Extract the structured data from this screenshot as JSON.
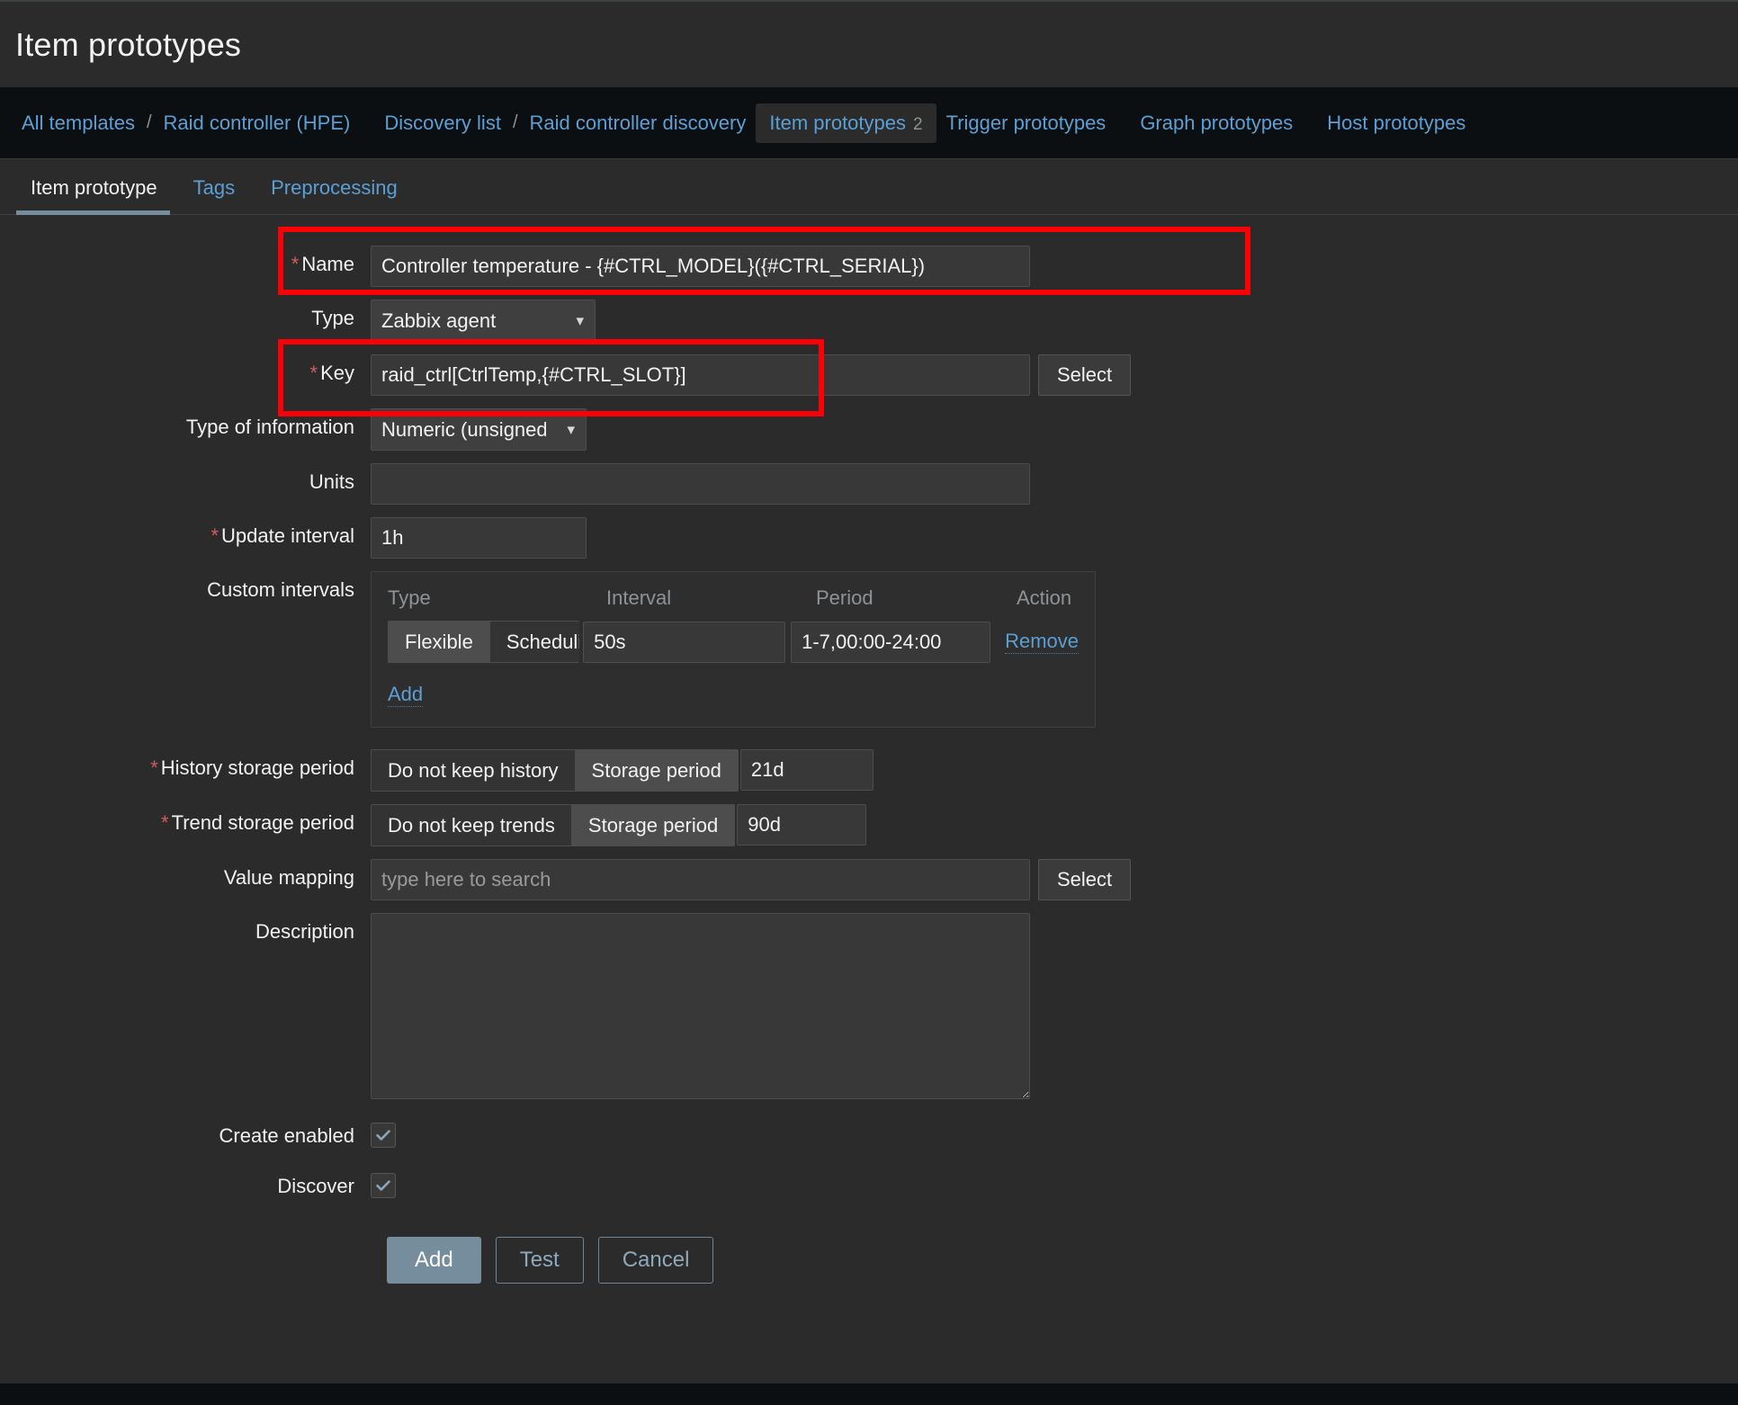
{
  "header": {
    "title": "Item prototypes"
  },
  "breadcrumb": {
    "items": [
      {
        "label": "All templates",
        "type": "link"
      },
      {
        "label": "/",
        "type": "sep"
      },
      {
        "label": "Raid controller (HPE)",
        "type": "link"
      },
      {
        "label": "",
        "type": "gap"
      },
      {
        "label": "Discovery list",
        "type": "link"
      },
      {
        "label": "/",
        "type": "sep"
      },
      {
        "label": "Raid controller discovery",
        "type": "link"
      }
    ],
    "active": {
      "label": "Item prototypes",
      "count": "2"
    },
    "trailing": [
      {
        "label": "Trigger prototypes"
      },
      {
        "label": "Graph prototypes"
      },
      {
        "label": "Host prototypes"
      }
    ]
  },
  "tabs": [
    {
      "label": "Item prototype",
      "active": true
    },
    {
      "label": "Tags",
      "active": false
    },
    {
      "label": "Preprocessing",
      "active": false
    }
  ],
  "form": {
    "name": {
      "label": "Name",
      "required": "*",
      "value": "Controller temperature - {#CTRL_MODEL}({#CTRL_SERIAL})"
    },
    "type": {
      "label": "Type",
      "value": "Zabbix agent",
      "options": [
        "Zabbix agent"
      ]
    },
    "key": {
      "label": "Key",
      "required": "*",
      "value": "raid_ctrl[CtrlTemp,{#CTRL_SLOT}]",
      "select_label": "Select"
    },
    "type_of_information": {
      "label": "Type of information",
      "value": "Numeric (unsigned)",
      "options": [
        "Numeric (unsigned)"
      ]
    },
    "units": {
      "label": "Units",
      "value": ""
    },
    "update_interval": {
      "label": "Update interval",
      "required": "*",
      "value": "1h"
    },
    "custom_intervals": {
      "label": "Custom intervals",
      "headers": {
        "type": "Type",
        "interval": "Interval",
        "period": "Period",
        "action": "Action"
      },
      "rows": [
        {
          "type_options": [
            "Flexible",
            "Scheduling"
          ],
          "type_selected": "Flexible",
          "interval": "50s",
          "period": "1-7,00:00-24:00",
          "action_label": "Remove"
        }
      ],
      "add_label": "Add"
    },
    "history_storage_period": {
      "label": "History storage period",
      "required": "*",
      "options": [
        "Do not keep history",
        "Storage period"
      ],
      "selected": "Storage period",
      "value": "21d"
    },
    "trend_storage_period": {
      "label": "Trend storage period",
      "required": "*",
      "options": [
        "Do not keep trends",
        "Storage period"
      ],
      "selected": "Storage period",
      "value": "90d"
    },
    "value_mapping": {
      "label": "Value mapping",
      "value": "",
      "placeholder": "type here to search",
      "select_label": "Select"
    },
    "description": {
      "label": "Description",
      "value": ""
    },
    "create_enabled": {
      "label": "Create enabled",
      "checked": true
    },
    "discover": {
      "label": "Discover",
      "checked": true
    }
  },
  "footer": {
    "add_label": "Add",
    "test_label": "Test",
    "cancel_label": "Cancel"
  },
  "colors": {
    "accent_link": "#5b9fd4",
    "primary_button": "#768d9e",
    "required_star": "#d65c5c",
    "annotation": "#fb0007",
    "panel_bg": "#2b2b2b",
    "page_bg": "#0c0f11"
  },
  "annotations": [
    {
      "name": "name-field-highlight"
    },
    {
      "name": "key-field-highlight"
    }
  ]
}
